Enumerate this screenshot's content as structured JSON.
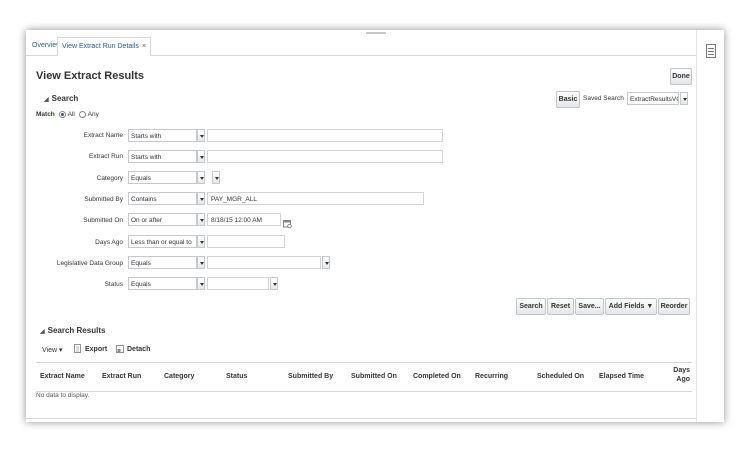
{
  "tabs": [
    {
      "label": "Overview"
    },
    {
      "label": "View Extract Run Details",
      "close": "×"
    }
  ],
  "page": {
    "title": "View Extract Results",
    "done_label": "Done"
  },
  "search": {
    "heading": "Search",
    "basic_label": "Basic",
    "saved_search_label": "Saved Search",
    "saved_search_value": "ExtractResultsVC",
    "match_label": "Match",
    "match_all": "All",
    "match_any": "Any",
    "fields": [
      {
        "label": "Extract Name",
        "operator": "Starts with",
        "value": ""
      },
      {
        "label": "Extract Run",
        "operator": "Starts with",
        "value": ""
      },
      {
        "label": "Category",
        "operator": "Equals",
        "value": ""
      },
      {
        "label": "Submitted By",
        "operator": "Contains",
        "value": "PAY_MGR_ALL"
      },
      {
        "label": "Submitted On",
        "operator": "On or after",
        "value": "8/18/15 12:00 AM"
      },
      {
        "label": "Days Ago",
        "operator": "Less than or equal to",
        "value": ""
      },
      {
        "label": "Legislative Data Group",
        "operator": "Equals",
        "value": ""
      },
      {
        "label": "Status",
        "operator": "Equals",
        "value": ""
      }
    ],
    "buttons": {
      "search": "Search",
      "reset": "Reset",
      "save": "Save...",
      "add_fields": "Add Fields ▼",
      "reorder": "Reorder"
    }
  },
  "results": {
    "heading": "Search Results",
    "view_label": "View ▾",
    "export_label": "Export",
    "detach_label": "Detach",
    "columns": [
      "Extract Name",
      "Extract Run",
      "Category",
      "Status",
      "Submitted By",
      "Submitted On",
      "Completed On",
      "Recurring",
      "Scheduled On",
      "Elapsed Time",
      "Days Ago"
    ],
    "empty_text": "No data to display."
  },
  "colors": {
    "link": "#25619d",
    "border": "#c5c9cd"
  }
}
